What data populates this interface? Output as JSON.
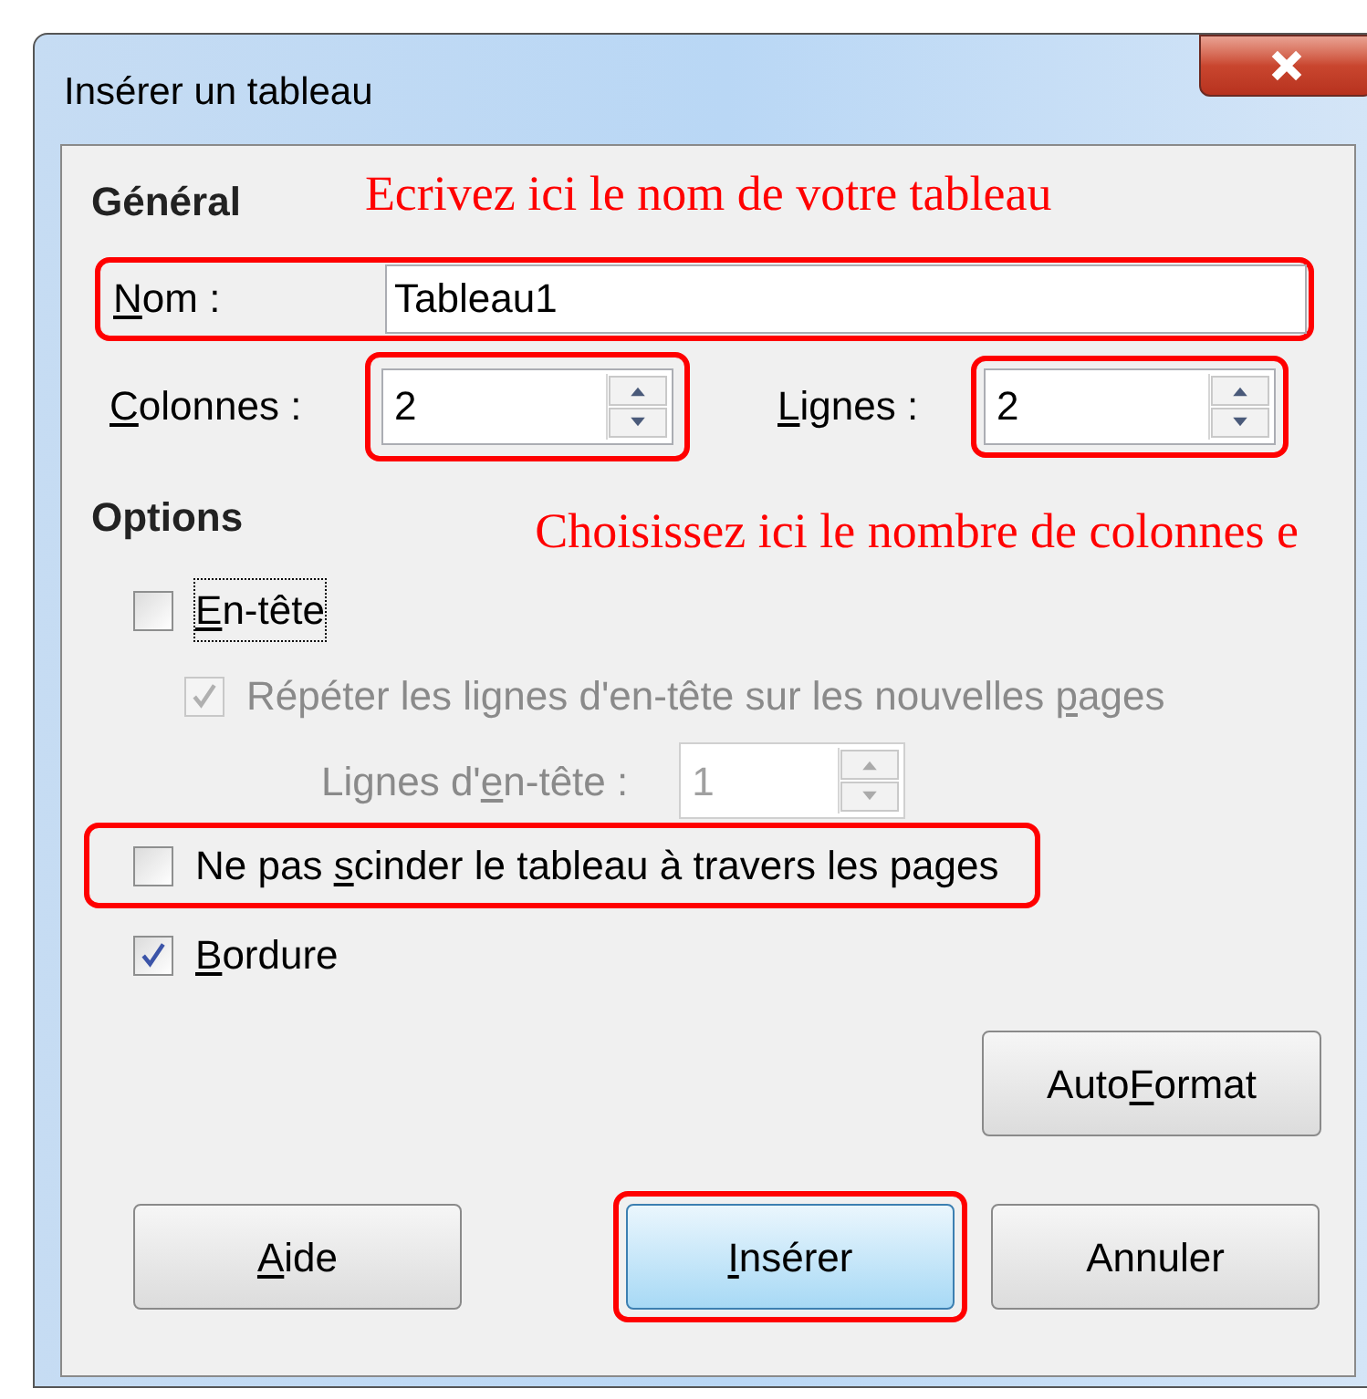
{
  "window": {
    "title": "Insérer un tableau"
  },
  "general": {
    "heading": "Général",
    "note": "Ecrivez ici le nom de votre tableau",
    "name": {
      "accel": "N",
      "post": "om :",
      "value": "Tableau1",
      "highlighted": true
    },
    "columns": {
      "accel": "C",
      "post": "olonnes :",
      "value": "2",
      "highlighted": true
    },
    "rows": {
      "accel": "L",
      "post": "ignes :",
      "value": "2",
      "highlighted": true
    }
  },
  "options": {
    "heading": "Options",
    "note": "Choisissez ici le nombre de colonnes e",
    "items": [
      {
        "kind": "checkbox",
        "accel": "E",
        "post": "n-tête",
        "checked": false,
        "disabled": false,
        "focused": true,
        "highlighted": false,
        "children": [
          {
            "kind": "checkbox",
            "pre": "Répéter les lignes d'en-tête sur les nouvelles ",
            "accel": "p",
            "post": "ages",
            "checked": true,
            "disabled": true,
            "focused": false,
            "highlighted": false,
            "children": [
              {
                "kind": "spin",
                "pre": "Lignes d'",
                "accel": "e",
                "post": "n-tête :",
                "value": "1",
                "disabled": true
              }
            ]
          }
        ]
      },
      {
        "kind": "checkbox",
        "pre": "Ne pas ",
        "accel": "s",
        "post": "cinder le tableau à travers les pages",
        "checked": false,
        "disabled": false,
        "focused": false,
        "highlighted": true
      },
      {
        "kind": "checkbox",
        "accel": "B",
        "post": "ordure",
        "checked": true,
        "disabled": false,
        "focused": false,
        "highlighted": false
      }
    ]
  },
  "autoformat": {
    "pre": "Auto",
    "accel": "F",
    "post": "ormat"
  },
  "buttons": [
    {
      "accel": "A",
      "post": "ide",
      "default": false,
      "highlighted": false
    },
    {
      "accel": "I",
      "post": "nsérer",
      "default": true,
      "highlighted": true
    },
    {
      "post": "Annuler",
      "default": false,
      "highlighted": false
    }
  ]
}
